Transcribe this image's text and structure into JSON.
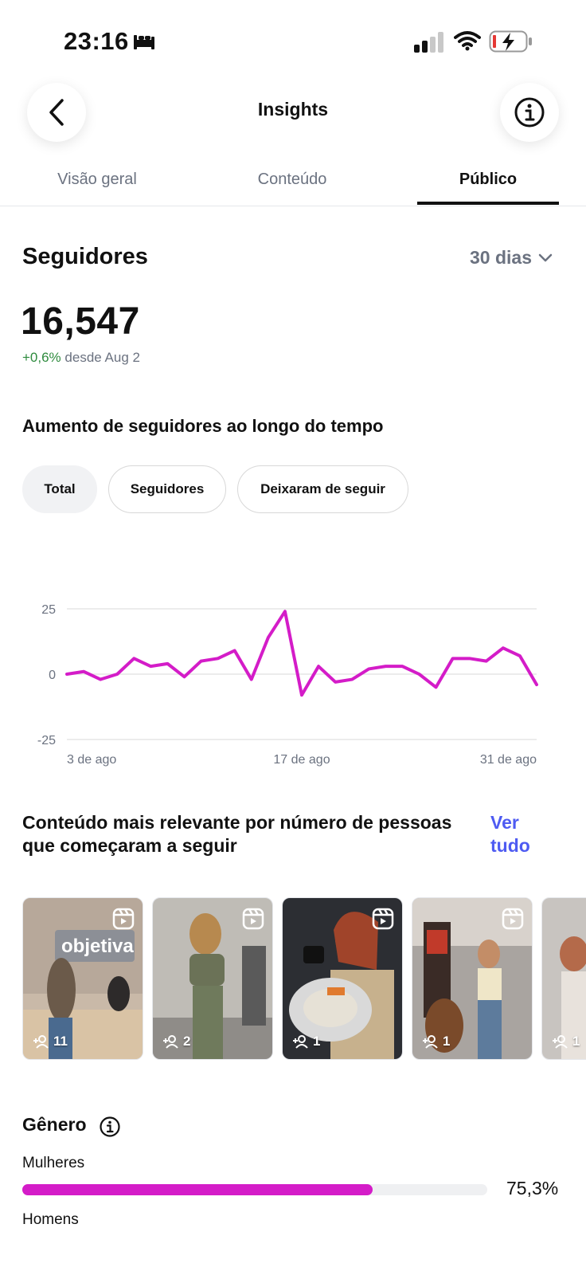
{
  "status_bar": {
    "time": "23:16"
  },
  "header": {
    "title": "Insights"
  },
  "tabs": [
    {
      "label": "Visão geral",
      "active": false
    },
    {
      "label": "Conteúdo",
      "active": false
    },
    {
      "label": "Público",
      "active": true
    }
  ],
  "followers": {
    "title": "Seguidores",
    "period": "30 dias",
    "count": "16,547",
    "change": "+0,6%",
    "change_since": "desde Aug 2"
  },
  "growth_chart": {
    "title": "Aumento de seguidores ao longo do tempo",
    "filters": [
      {
        "label": "Total",
        "active": true
      },
      {
        "label": "Seguidores",
        "active": false
      },
      {
        "label": "Deixaram de seguir",
        "active": false
      }
    ]
  },
  "chart_data": {
    "type": "line",
    "title": "",
    "xlabel": "",
    "ylabel": "",
    "ylim": [
      -25,
      25
    ],
    "yticks": [
      "25",
      "0",
      "-25"
    ],
    "xticks": [
      "3 de ago",
      "17 de ago",
      "31 de ago"
    ],
    "x": [
      "3 ago",
      "4 ago",
      "5 ago",
      "6 ago",
      "7 ago",
      "8 ago",
      "9 ago",
      "10 ago",
      "11 ago",
      "12 ago",
      "13 ago",
      "14 ago",
      "15 ago",
      "16 ago",
      "17 ago",
      "18 ago",
      "19 ago",
      "20 ago",
      "21 ago",
      "22 ago",
      "23 ago",
      "24 ago",
      "25 ago",
      "26 ago",
      "27 ago",
      "28 ago",
      "29 ago",
      "30 ago",
      "31 ago"
    ],
    "series": [
      {
        "color": "#d41cc8",
        "values": [
          0,
          1,
          -2,
          0,
          6,
          3,
          4,
          -1,
          5,
          6,
          9,
          -2,
          14,
          24,
          -8,
          3,
          -3,
          -2,
          2,
          3,
          3,
          0,
          -5,
          6,
          6,
          5,
          10,
          7,
          -4
        ]
      }
    ],
    "grid": true
  },
  "top_content": {
    "title": "Conteúdo mais relevante por número de pessoas que começaram a seguir",
    "see_all": "Ver tudo",
    "items": [
      {
        "count": "11",
        "icon": "reels-icon"
      },
      {
        "count": "2",
        "icon": "reels-icon"
      },
      {
        "count": "1",
        "icon": "reels-icon"
      },
      {
        "count": "1",
        "icon": "reels-icon"
      },
      {
        "count": "1",
        "icon": "reels-icon"
      }
    ]
  },
  "gender": {
    "title": "Gênero",
    "women_label": "Mulheres",
    "women_value": "75,3%",
    "women_fraction": 0.753,
    "men_label": "Homens"
  },
  "colors": {
    "accent": "#d41cc8",
    "link": "#4e5bf2",
    "positive": "#2e8b3e"
  }
}
